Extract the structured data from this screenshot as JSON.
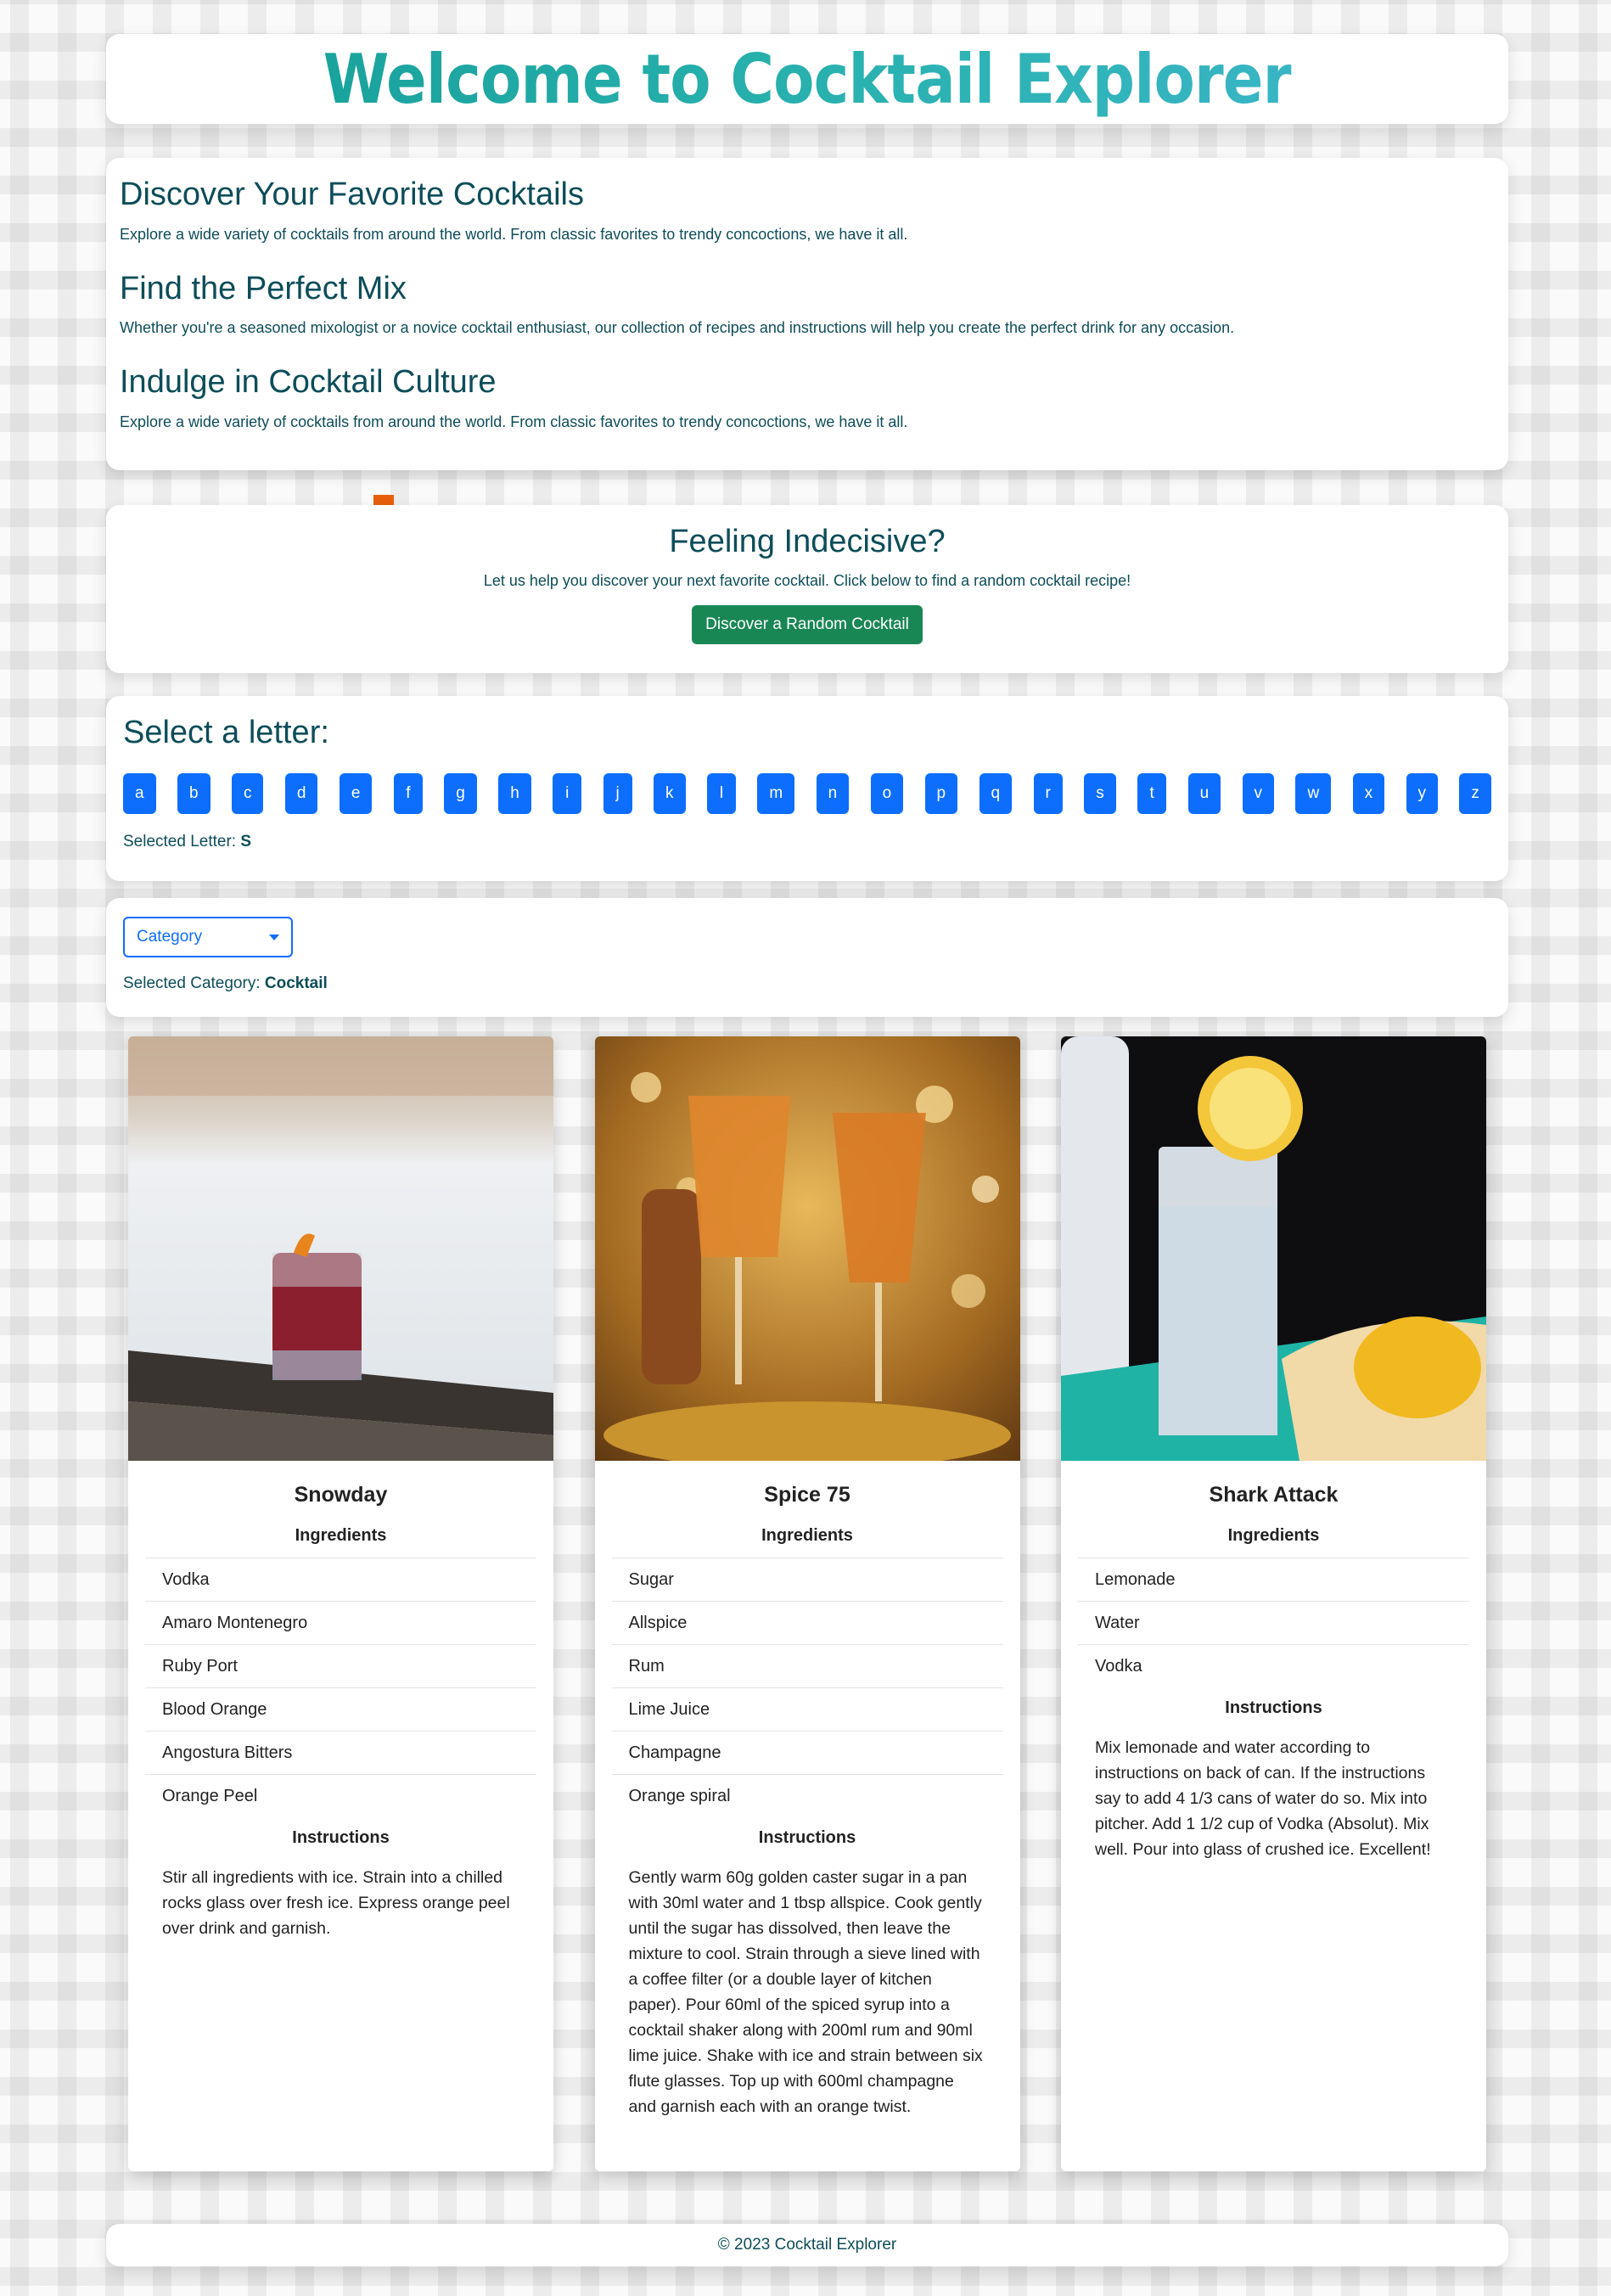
{
  "header": {
    "title": "Welcome to Cocktail Explorer"
  },
  "intro": {
    "sections": [
      {
        "heading": "Discover Your Favorite Cocktails",
        "text": "Explore a wide variety of cocktails from around the world. From classic favorites to trendy concoctions, we have it all."
      },
      {
        "heading": "Find the Perfect Mix",
        "text": "Whether you're a seasoned mixologist or a novice cocktail enthusiast, our collection of recipes and instructions will help you create the perfect drink for any occasion."
      },
      {
        "heading": "Indulge in Cocktail Culture",
        "text": "Explore a wide variety of cocktails from around the world. From classic favorites to trendy concoctions, we have it all."
      }
    ]
  },
  "random": {
    "heading": "Feeling Indecisive?",
    "text": "Let us help you discover your next favorite cocktail. Click below to find a random cocktail recipe!",
    "button_label": "Discover a Random Cocktail"
  },
  "letters": {
    "heading": "Select a letter:",
    "items": [
      "a",
      "b",
      "c",
      "d",
      "e",
      "f",
      "g",
      "h",
      "i",
      "j",
      "k",
      "l",
      "m",
      "n",
      "o",
      "p",
      "q",
      "r",
      "s",
      "t",
      "u",
      "v",
      "w",
      "x",
      "y",
      "z"
    ],
    "selected_label": "Selected Letter:",
    "selected_value": "S"
  },
  "category": {
    "dropdown_label": "Category",
    "selected_label": "Selected Category:",
    "selected_value": "Cocktail"
  },
  "drinks": [
    {
      "name": "Snowday",
      "ingredients_label": "Ingredients",
      "ingredients": [
        "Vodka",
        "Amaro Montenegro",
        "Ruby Port",
        "Blood Orange",
        "Angostura Bitters",
        "Orange Peel"
      ],
      "instructions_label": "Instructions",
      "instructions": "Stir all ingredients with ice. Strain into a chilled rocks glass over fresh ice. Express orange peel over drink and garnish."
    },
    {
      "name": "Spice 75",
      "ingredients_label": "Ingredients",
      "ingredients": [
        "Sugar",
        "Allspice",
        "Rum",
        "Lime Juice",
        "Champagne",
        "Orange spiral"
      ],
      "instructions_label": "Instructions",
      "instructions": "Gently warm 60g golden caster sugar in a pan with 30ml water and 1 tbsp allspice. Cook gently until the sugar has dissolved, then leave the mixture to cool. Strain through a sieve lined with a coffee filter (or a double layer of kitchen paper).  Pour 60ml of the spiced syrup into a cocktail shaker along with 200ml rum and 90ml lime juice. Shake with ice and strain between six flute glasses. Top up with 600ml champagne and garnish each with an orange twist."
    },
    {
      "name": "Shark Attack",
      "ingredients_label": "Ingredients",
      "ingredients": [
        "Lemonade",
        "Water",
        "Vodka"
      ],
      "instructions_label": "Instructions",
      "instructions": "Mix lemonade and water according to instructions on back of can. If the instructions say to add 4 1/3 cans of water do so. Mix into pitcher. Add 1 1/2 cup of Vodka (Absolut). Mix well. Pour into glass of crushed ice. Excellent!"
    }
  ],
  "footer": {
    "text": "© 2023 Cocktail Explorer"
  },
  "colors": {
    "brand_teal": "#1aa39d",
    "heading": "#0d4d5a",
    "primary_blue": "#0d6efd",
    "success_green": "#198754",
    "accent_orange": "#f47b20"
  }
}
